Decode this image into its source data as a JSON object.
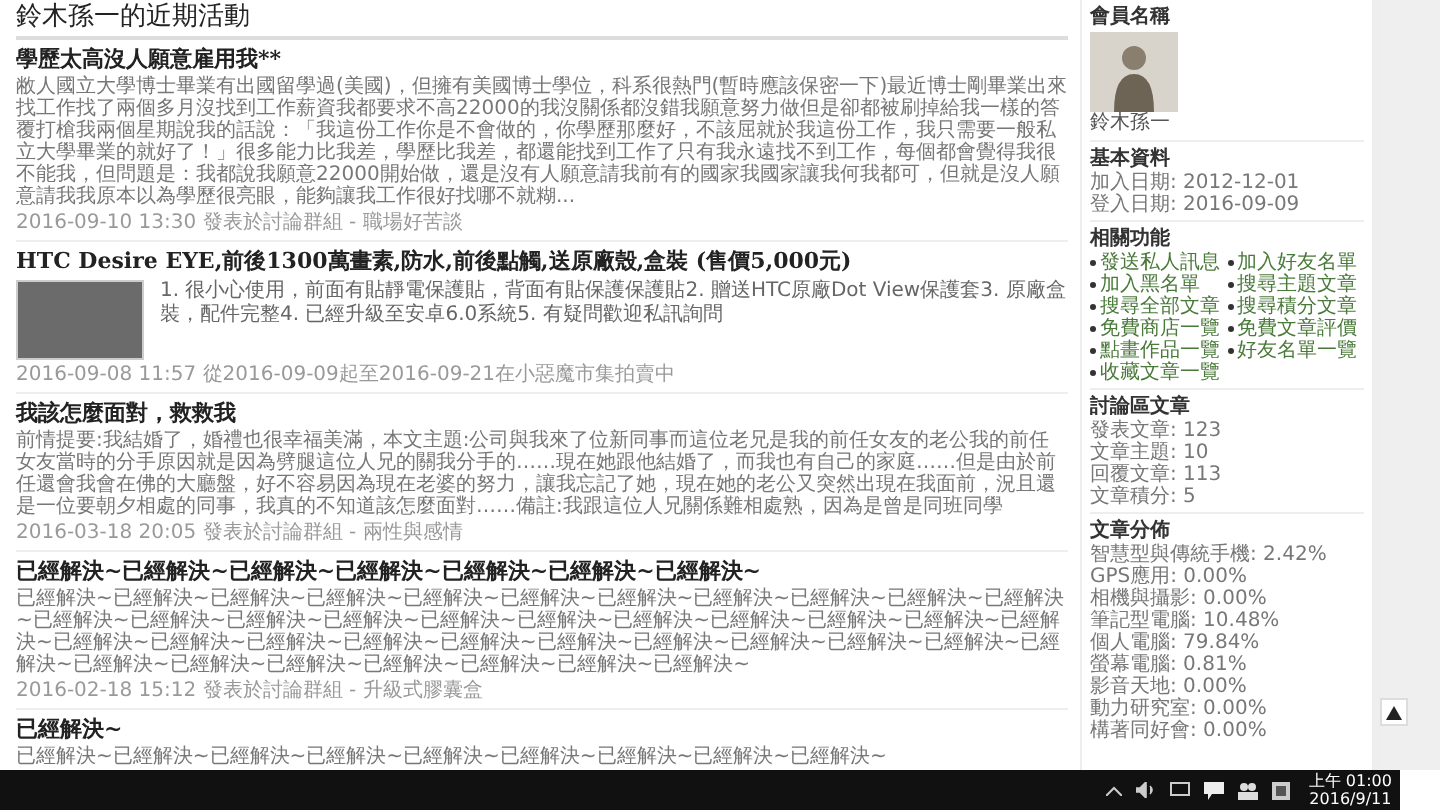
{
  "page_title": "鈴木孫一的近期活動",
  "posts": [
    {
      "kind": "text",
      "title": "學歷太高沒人願意雇用我**",
      "body": "敝人國立大學博士畢業有出國留學過(美國)，但擁有美國博士學位，科系很熱門(暫時應該保密一下)最近博士剛畢業出來找工作找了兩個多月沒找到工作薪資我都要求不高22000的我沒關係都沒錯我願意努力做但是卻都被刷掉給我一樣的答覆打槍我兩個星期說我的話說：「我這份工作你是不會做的，你學歷那麼好，不該屈就於我這份工作，我只需要一般私立大學畢業的就好了！」很多能力比我差，學歷比我差，都還能找到工作了只有我永遠找不到工作，每個都會覺得我很不能我，但問題是：我都說我願意22000開始做，還是沒有人願意請我前有的國家我國家讓我何我都可，但就是沒人願意請我我原本以為學歷很亮眼，能夠讓我工作很好找哪不就糊...",
      "meta": "2016-09-10 13:30 發表於討論群組 - 職場好苦談"
    },
    {
      "kind": "sale",
      "title": "HTC Desire EYE,前後1300萬畫素,防水,前後點觸,送原廠殼,盒裝 (售價5,000元)",
      "body": "1. 很小心使用，前面有貼靜電保護貼，背面有貼保護保護貼2. 贈送HTC原廠Dot View保護套3. 原廠盒裝，配件完整4. 已經升級至安卓6.0系統5. 有疑問歡迎私訊詢問",
      "meta": "2016-09-08 11:57 從2016-09-09起至2016-09-21在小惡魔市集拍賣中"
    },
    {
      "kind": "text",
      "title": "我該怎麼面對，救救我",
      "body": "前情提要:我結婚了，婚禮也很幸福美滿，本文主題:公司與我來了位新同事而這位老兄是我的前任女友的老公我的前任女友當時的分手原因就是因為劈腿這位人兄的關我分手的……現在她跟他結婚了，而我也有自己的家庭……但是由於前任還會我會在佛的大廳盤，好不容易因為現在老婆的努力，讓我忘記了她，現在她的老公又突然出現在我面前，況且還是一位要朝夕相處的同事，我真的不知道該怎麼面對……備註:我跟這位人兄關係難相處熟，因為是曾是同班同學",
      "meta": "2016-03-18 20:05 發表於討論群組 - 兩性與感情"
    },
    {
      "kind": "text",
      "title": "已經解決~已經解決~已經解決~已經解決~已經解決~已經解決~已經解決~",
      "body": "已經解決~已經解決~已經解決~已經解決~已經解決~已經解決~已經解決~已經解決~已經解決~已經解決~已經解決~已經解決~已經解決~已經解決~已經解決~已經解決~已經解決~已經解決~已經解決~已經解決~已經解決~已經解決~已經解決~已經解決~已經解決~已經解決~已經解決~已經解決~已經解決~已經解決~已經解決~已經解決~已經解決~已經解決~已經解決~已經解決~已經解決~已經解決~已經解決~已經解決~",
      "meta": "2016-02-18 15:12 發表於討論群組 - 升級式膠囊盒"
    },
    {
      "kind": "text",
      "title": "已經解決~",
      "body": "已經解決~已經解決~已經解決~已經解決~已經解決~已經解決~已經解決~已經解決~已經解決~"
    }
  ],
  "sidebar": {
    "member_heading": "會員名稱",
    "member_name": "鈴木孫一",
    "basic": {
      "heading": "基本資料",
      "lines": [
        "加入日期: 2012-12-01",
        "登入日期: 2016-09-09"
      ]
    },
    "functions": {
      "heading": "相關功能",
      "links": [
        "發送私人訊息",
        "加入好友名單",
        "加入黑名單",
        "搜尋主題文章",
        "搜尋全部文章",
        "搜尋積分文章",
        "免費商店一覽",
        "免費文章評價",
        "點畫作品一覽",
        "好友名單一覽",
        "收藏文章一覽"
      ]
    },
    "forum": {
      "heading": "討論區文章",
      "lines": [
        "發表文章: 123",
        "文章主題: 10",
        "回覆文章: 113",
        "文章積分: 5"
      ]
    },
    "distribution": {
      "heading": "文章分佈",
      "lines": [
        "智慧型與傳統手機: 2.42%",
        "GPS應用: 0.00%",
        "相機與攝影: 0.00%",
        "筆記型電腦: 10.48%",
        "個人電腦: 79.84%",
        "螢幕電腦: 0.81%",
        "影音天地: 0.00%",
        "動力研究室: 0.00%",
        "構著同好會: 0.00%"
      ]
    }
  },
  "taskbar": {
    "time": "上午 01:00",
    "date": "2016/9/11"
  }
}
